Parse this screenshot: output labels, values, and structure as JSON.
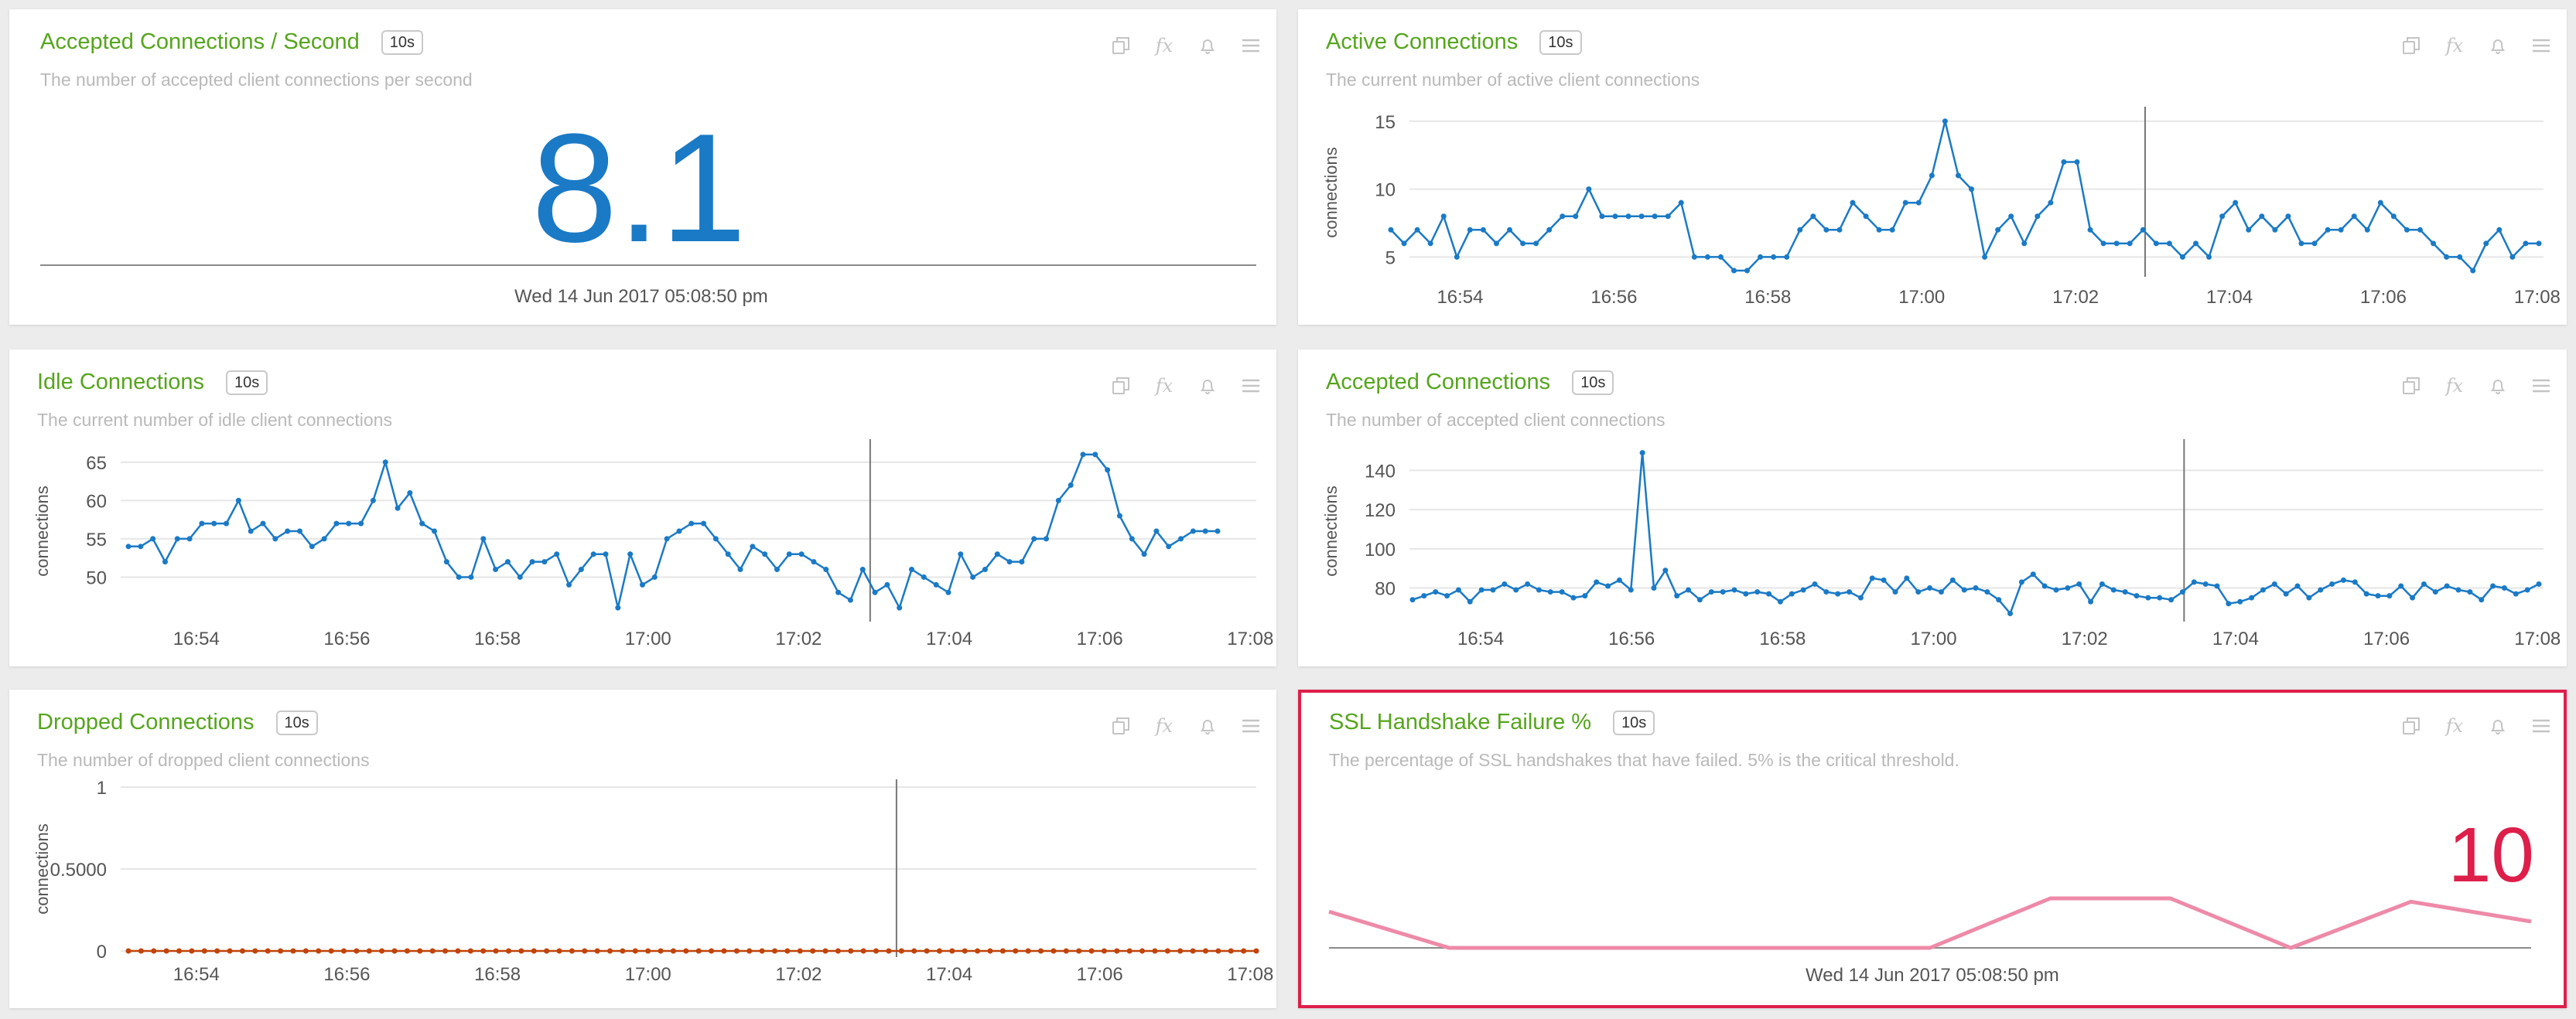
{
  "colors": {
    "title": "#55a51c",
    "line": "#1a7ac6",
    "dropped": "#c0440c",
    "ssl": "#ee8aa8",
    "critical": "#dd1f4a",
    "big": "#1a7ac6"
  },
  "icons": [
    "copy-icon",
    "fx-icon",
    "bell-icon",
    "menu-icon"
  ],
  "tools": {
    "fx": "fx"
  },
  "panels": {
    "accepted_per_second": {
      "title": "Accepted Connections / Second",
      "badge": "10s",
      "description": "The number of accepted client connections per second",
      "value": "8.1",
      "timestamp": "Wed 14 Jun 2017 05:08:50 pm"
    },
    "active": {
      "title": "Active Connections",
      "badge": "10s",
      "description": "The current number of active client connections"
    },
    "idle": {
      "title": "Idle Connections",
      "badge": "10s",
      "description": "The current number of idle client connections"
    },
    "accepted": {
      "title": "Accepted Connections",
      "badge": "10s",
      "description": "The number of accepted client connections"
    },
    "dropped": {
      "title": "Dropped Connections",
      "badge": "10s",
      "description": "The number of dropped client connections"
    },
    "ssl": {
      "title": "SSL Handshake Failure %",
      "badge": "10s",
      "description": "The percentage of SSL handshakes that have failed. 5% is the critical threshold.",
      "value": "10",
      "timestamp": "Wed 14 Jun 2017 05:08:50 pm"
    }
  },
  "chart_data": [
    {
      "id": "active",
      "type": "line",
      "ylabel": "connections",
      "ylim": [
        4,
        15.5
      ],
      "yticks": [
        5,
        10,
        15
      ],
      "ytick_labels": [
        "5",
        "10",
        "15"
      ],
      "xlim": [
        0,
        100
      ],
      "xtick_labels": [
        "16:54",
        "16:56",
        "16:58",
        "17:00",
        "17:02",
        "17:04",
        "17:06",
        "17:08"
      ],
      "cursor": 0.657,
      "values": [
        7,
        6,
        7,
        6,
        8,
        5,
        7,
        7,
        6,
        7,
        6,
        6,
        7,
        8,
        8,
        10,
        8,
        8,
        8,
        8,
        8,
        8,
        9,
        5,
        5,
        5,
        4,
        4,
        5,
        5,
        5,
        7,
        8,
        7,
        7,
        9,
        8,
        7,
        7,
        9,
        9,
        11,
        15,
        11,
        10,
        5,
        7,
        8,
        6,
        8,
        9,
        12,
        12,
        7,
        6,
        6,
        6,
        7,
        6,
        6,
        5,
        6,
        5,
        8,
        9,
        7,
        8,
        7,
        8,
        6,
        6,
        7,
        7,
        8,
        7,
        9,
        8,
        7,
        7,
        6,
        5,
        5,
        4,
        6,
        7,
        5,
        6,
        6
      ]
    },
    {
      "id": "idle",
      "type": "line",
      "ylabel": "connections",
      "ylim": [
        45,
        67
      ],
      "yticks": [
        50,
        55,
        60,
        65
      ],
      "ytick_labels": [
        "50",
        "55",
        "60",
        "65"
      ],
      "xlim": [
        0,
        100
      ],
      "xtick_labels": [
        "16:54",
        "16:56",
        "16:58",
        "17:00",
        "17:02",
        "17:04",
        "17:06",
        "17:08"
      ],
      "cursor": 0.681,
      "values": [
        54,
        54,
        55,
        52,
        55,
        55,
        57,
        57,
        57,
        60,
        56,
        57,
        55,
        56,
        56,
        54,
        55,
        57,
        57,
        57,
        60,
        65,
        59,
        61,
        57,
        56,
        52,
        50,
        50,
        55,
        51,
        52,
        50,
        52,
        52,
        53,
        49,
        51,
        53,
        53,
        46,
        53,
        49,
        50,
        55,
        56,
        57,
        57,
        55,
        53,
        51,
        54,
        53,
        51,
        53,
        53,
        52,
        51,
        48,
        47,
        51,
        48,
        49,
        46,
        51,
        50,
        49,
        48,
        53,
        50,
        51,
        53,
        52,
        52,
        55,
        55,
        60,
        62,
        66,
        66,
        64,
        58,
        55,
        53,
        56,
        54,
        55,
        56,
        56,
        56
      ]
    },
    {
      "id": "accepted",
      "type": "line",
      "ylabel": "connections",
      "ylim": [
        66,
        152
      ],
      "yticks": [
        80,
        100,
        120,
        140
      ],
      "ytick_labels": [
        "80",
        "100",
        "120",
        "140"
      ],
      "xlim": [
        0,
        100
      ],
      "xtick_labels": [
        "16:54",
        "16:56",
        "16:58",
        "17:00",
        "17:02",
        "17:04",
        "17:06",
        "17:08"
      ],
      "cursor": 0.685,
      "values": [
        74,
        76,
        78,
        76,
        79,
        73,
        79,
        79,
        82,
        79,
        82,
        79,
        78,
        78,
        75,
        76,
        83,
        81,
        84,
        79,
        149,
        80,
        89,
        76,
        79,
        74,
        78,
        78,
        79,
        77,
        78,
        77,
        73,
        77,
        79,
        82,
        78,
        77,
        78,
        75,
        85,
        84,
        78,
        85,
        78,
        80,
        78,
        84,
        79,
        80,
        78,
        74,
        67,
        83,
        87,
        81,
        79,
        80,
        82,
        73,
        82,
        79,
        78,
        76,
        75,
        75,
        74,
        78,
        83,
        82,
        81,
        72,
        73,
        75,
        79,
        82,
        77,
        81,
        75,
        79,
        82,
        84,
        83,
        77,
        76,
        76,
        81,
        75,
        82,
        78,
        81,
        79,
        78,
        74,
        81,
        80,
        77,
        79,
        82
      ]
    },
    {
      "id": "dropped",
      "type": "line",
      "ylabel": "connections",
      "ylim": [
        0,
        1
      ],
      "yticks": [
        0,
        0.5,
        1
      ],
      "ytick_labels": [
        "0",
        "0.5000",
        "1"
      ],
      "xlim": [
        0,
        100
      ],
      "xtick_labels": [
        "16:54",
        "16:56",
        "16:58",
        "17:00",
        "17:02",
        "17:04",
        "17:06",
        "17:08"
      ],
      "cursor": 0.681,
      "values": [
        0,
        0,
        0,
        0,
        0,
        0,
        0,
        0,
        0,
        0,
        0,
        0,
        0,
        0,
        0,
        0,
        0,
        0,
        0,
        0,
        0,
        0,
        0,
        0,
        0,
        0,
        0,
        0,
        0,
        0,
        0,
        0,
        0,
        0,
        0,
        0,
        0,
        0,
        0,
        0,
        0,
        0,
        0,
        0,
        0,
        0,
        0,
        0,
        0,
        0,
        0,
        0,
        0,
        0,
        0,
        0,
        0,
        0,
        0,
        0,
        0,
        0,
        0,
        0,
        0,
        0,
        0,
        0,
        0,
        0,
        0,
        0,
        0,
        0,
        0,
        0,
        0,
        0,
        0,
        0,
        0,
        0,
        0,
        0,
        0,
        0,
        0,
        0,
        0,
        0
      ]
    },
    {
      "id": "ssl",
      "type": "area",
      "ylim": [
        0,
        15
      ],
      "values": [
        11,
        0,
        0,
        0,
        0,
        0,
        15,
        15,
        0,
        14,
        8
      ]
    }
  ]
}
